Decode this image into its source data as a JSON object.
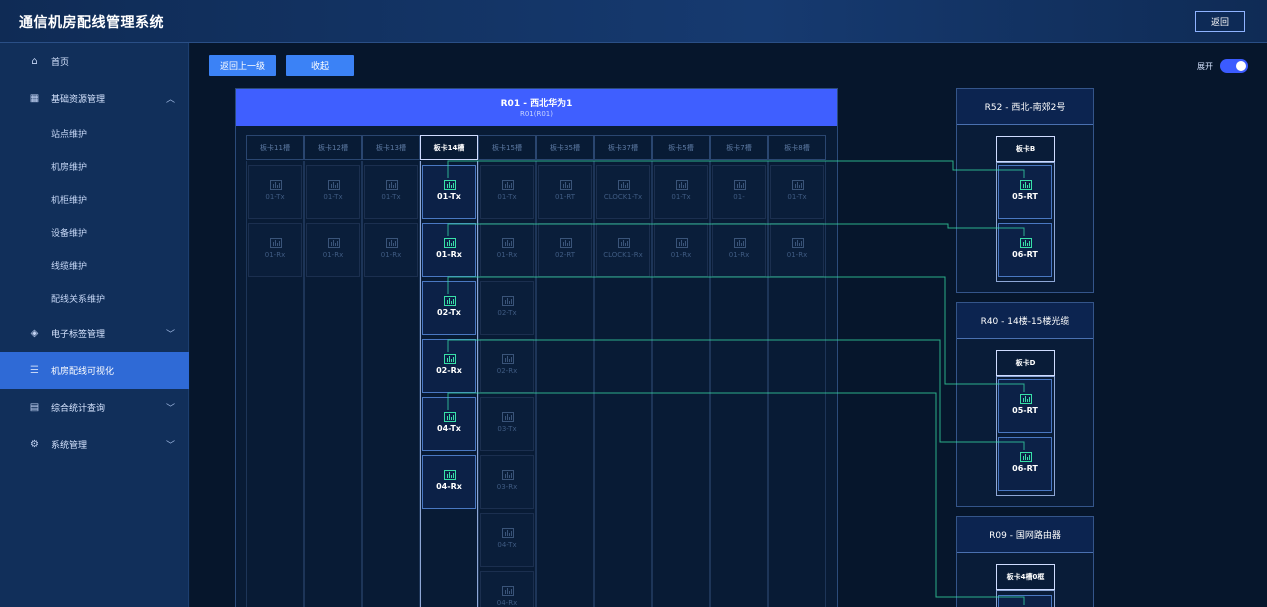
{
  "app": {
    "title": "通信机房配线管理系统",
    "back_label": "返回"
  },
  "sidebar": {
    "items": [
      {
        "label": "首页",
        "icon": "home-icon",
        "expandable": false
      },
      {
        "label": "基础资源管理",
        "icon": "database-icon",
        "expandable": true,
        "expanded": true,
        "children": [
          "站点维护",
          "机房维护",
          "机柜维护",
          "设备维护",
          "线缆维护",
          "配线关系维护"
        ]
      },
      {
        "label": "电子标签管理",
        "icon": "tag-icon",
        "expandable": true
      },
      {
        "label": "机房配线可视化",
        "icon": "server-icon",
        "expandable": false,
        "active": true
      },
      {
        "label": "综合统计查询",
        "icon": "chart-icon",
        "expandable": true
      },
      {
        "label": "系统管理",
        "icon": "gear-icon",
        "expandable": true
      }
    ]
  },
  "toolbar": {
    "back_level_label": "返回上一级",
    "collapse_label": "收起",
    "expand_label": "展开",
    "expand_on": true
  },
  "frame": {
    "title": "R01 - 西北华为1",
    "subtitle": "R01(R01)",
    "columns": [
      {
        "label": "板卡11槽",
        "ports": [
          "01-Tx",
          "01-Rx"
        ]
      },
      {
        "label": "板卡12槽",
        "ports": [
          "01-Tx",
          "01-Rx"
        ]
      },
      {
        "label": "板卡13槽",
        "ports": [
          "01-Tx",
          "01-Rx"
        ]
      },
      {
        "label": "板卡14槽",
        "active": true,
        "ports": [
          "01-Tx",
          "01-Rx",
          "02-Tx",
          "02-Rx",
          "04-Tx",
          "04-Rx"
        ]
      },
      {
        "label": "板卡15槽",
        "ports": [
          "01-Tx",
          "01-Rx",
          "02-Tx",
          "02-Rx",
          "03-Tx",
          "03-Rx",
          "04-Tx",
          "04-Rx"
        ]
      },
      {
        "label": "板卡35槽",
        "ports": [
          "01-RT",
          "02-RT"
        ]
      },
      {
        "label": "板卡37槽",
        "ports": [
          "CLOCK1-Tx",
          "CLOCK1-Rx"
        ]
      },
      {
        "label": "板卡5槽",
        "ports": [
          "01-Tx",
          "01-Rx"
        ]
      },
      {
        "label": "板卡7槽",
        "ports": [
          "01-",
          "01-Rx"
        ]
      },
      {
        "label": "板卡8槽",
        "ports": [
          "01-Tx",
          "01-Rx"
        ]
      }
    ]
  },
  "devices": [
    {
      "title": "R52 - 西北-南郊2号",
      "card": "板卡B",
      "ports": [
        "05-RT",
        "06-RT"
      ]
    },
    {
      "title": "R40 - 14楼-15楼光缆",
      "card": "板卡D",
      "ports": [
        "05-RT",
        "06-RT"
      ]
    },
    {
      "title": "R09 - 国网路由器",
      "card": "板卡4槽0框",
      "ports": []
    }
  ],
  "colors": {
    "accent": "#3b82f6",
    "frame_head": "#3f5fff",
    "link": "#38e0a8",
    "active_nav": "#2f6ad6"
  }
}
